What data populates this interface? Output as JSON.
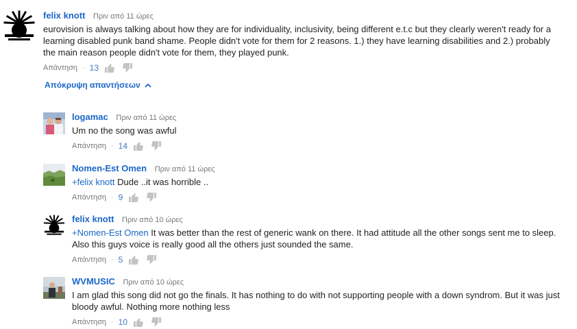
{
  "comments": [
    {
      "author": "felix knott",
      "time": "Πριν από 11 ώρες",
      "mention": "",
      "text": "eurovision is always talking about how they are for individuality, inclusivity, being different e.t.c but they clearly weren't ready for a learning disabled punk band shame. People didn't vote for them for 2 reasons. 1.) they have learning disabilities and 2.) probably the main reason people didn't vote for them, they played punk.",
      "reply_label": "Απάντηση",
      "likes": "13",
      "avatar_icon": "sun-logo-avatar"
    }
  ],
  "hide_replies_label": "Απόκρυψη απαντήσεων",
  "replies": [
    {
      "author": "logamac",
      "time": "Πριν από 11 ώρες",
      "mention": "",
      "text": "Um no the song was awful",
      "reply_label": "Απάντηση",
      "likes": "14",
      "avatar_icon": "photo-avatar"
    },
    {
      "author": "Nomen-Est Omen",
      "time": "Πριν από 11 ώρες",
      "mention": "+felix knott",
      "text": " Dude ..it was horrible ..",
      "reply_label": "Απάντηση",
      "likes": "9",
      "avatar_icon": "landscape-avatar"
    },
    {
      "author": "felix knott",
      "time": "Πριν από 10 ώρες",
      "mention": "+Nomen-Est Omen",
      "text": " It was better than the rest of generic wank on there. It had attitude all the other songs sent me to sleep. Also this guys voice is really good all the others just sounded the same.",
      "reply_label": "Απάντηση",
      "likes": "5",
      "avatar_icon": "sun-logo-avatar"
    },
    {
      "author": "WVMUSIC",
      "time": "Πριν από 10 ώρες",
      "mention": "",
      "text": "I am glad this song did not go the finals. It has nothing to do with not supporting people with a down syndrom. But it was just bloody awful. Nothing more nothing less",
      "reply_label": "Απάντηση",
      "likes": "10",
      "avatar_icon": "person-photo-avatar"
    }
  ],
  "colors": {
    "link": "#1a66c9",
    "meta": "#767676",
    "count": "#4279c8"
  }
}
